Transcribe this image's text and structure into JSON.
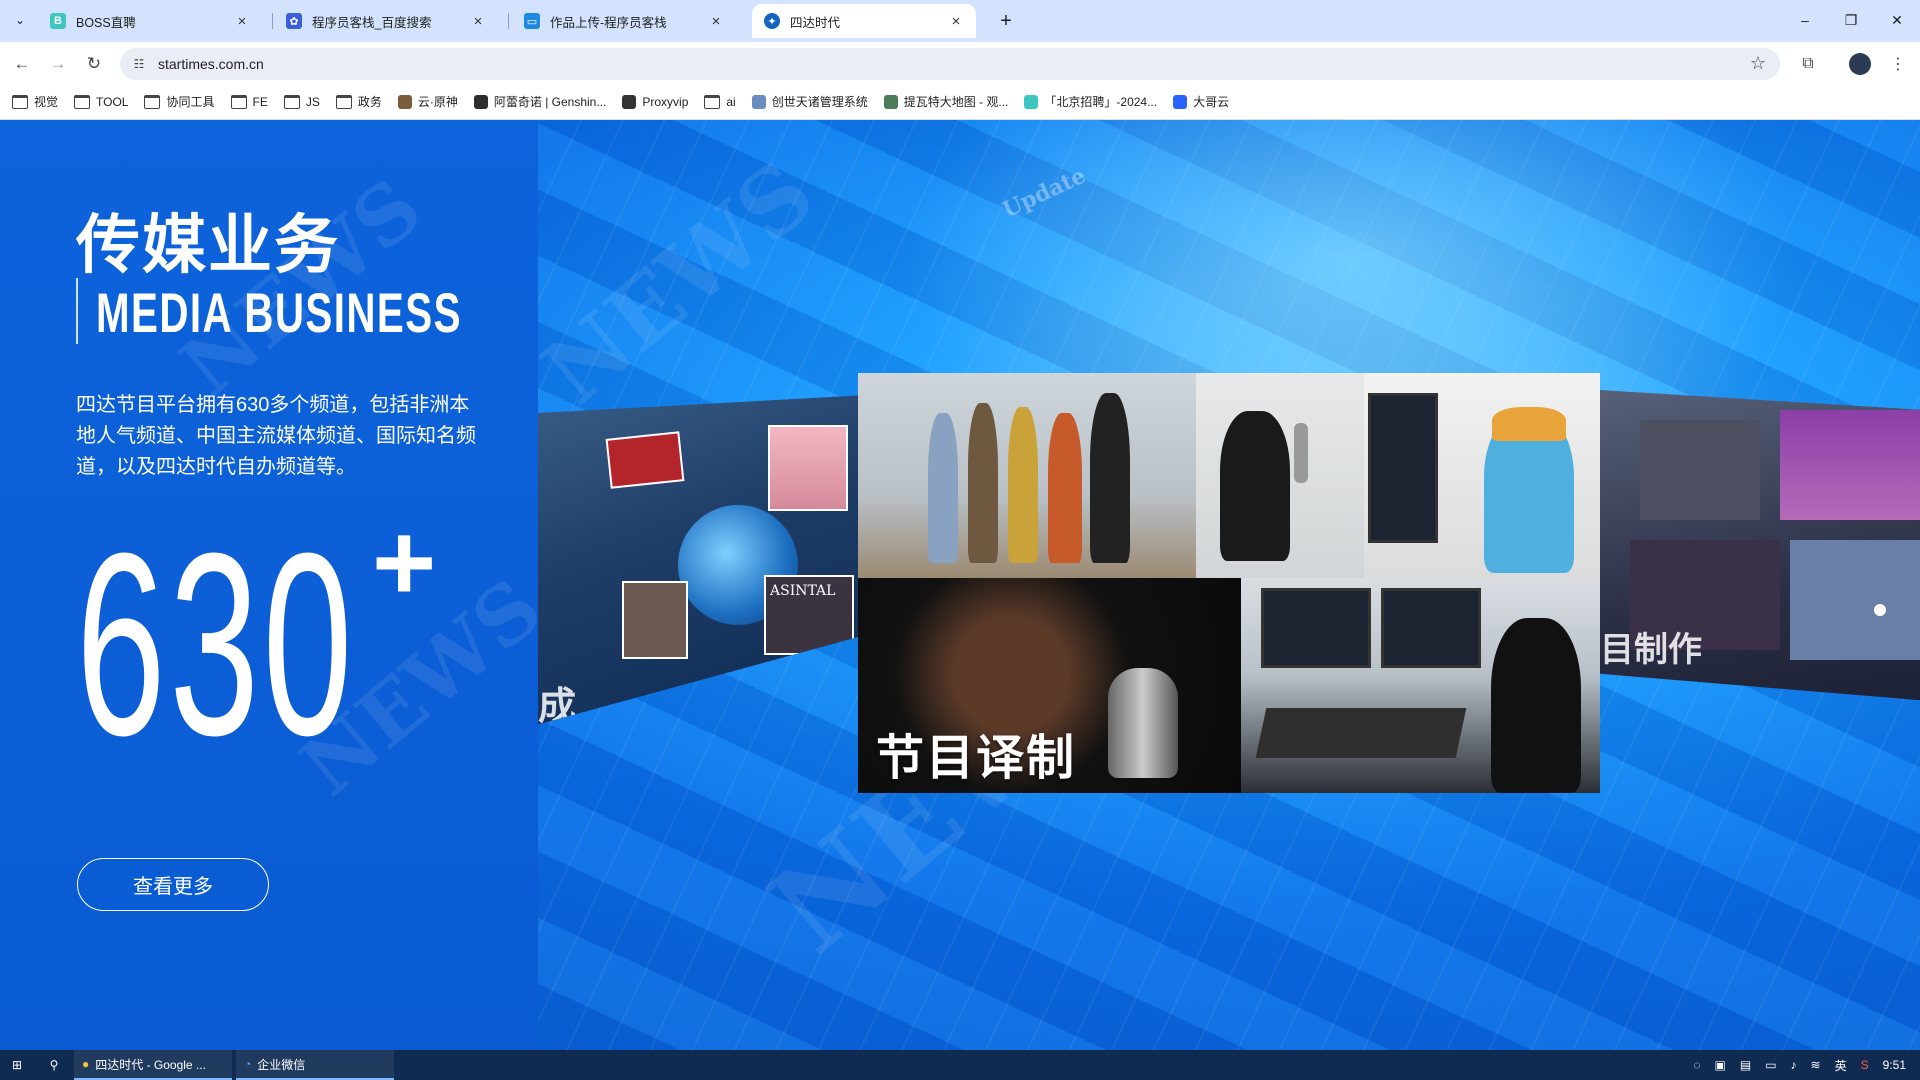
{
  "browser": {
    "tabs": [
      {
        "title": "BOSS直聘",
        "favicon": "B",
        "favicon_color": "#3fc6c0",
        "active": false
      },
      {
        "title": "程序员客栈_百度搜索",
        "favicon": "paw",
        "favicon_color": "#3a5fd9",
        "active": false
      },
      {
        "title": "作品上传-程序员客栈",
        "favicon": "box",
        "favicon_color": "#1e88e5",
        "active": false
      },
      {
        "title": "四达时代",
        "favicon": "globe",
        "favicon_color": "#1565c0",
        "active": true
      }
    ],
    "url": "startimes.com.cn",
    "bookmarks": [
      {
        "label": "视觉",
        "type": "folder"
      },
      {
        "label": "TOOL",
        "type": "folder"
      },
      {
        "label": "协同工具",
        "type": "folder"
      },
      {
        "label": "FE",
        "type": "folder"
      },
      {
        "label": "JS",
        "type": "folder"
      },
      {
        "label": "政务",
        "type": "folder"
      },
      {
        "label": "云·原神",
        "type": "site",
        "color": "#7a5c3a"
      },
      {
        "label": "阿蕾奇诺 | Genshin...",
        "type": "site",
        "color": "#2d2d2d"
      },
      {
        "label": "Proxyvip",
        "type": "site",
        "color": "#333333"
      },
      {
        "label": "ai",
        "type": "folder"
      },
      {
        "label": "创世天诸管理系统",
        "type": "site",
        "color": "#6c8ebf"
      },
      {
        "label": "提瓦特大地图 - 观...",
        "type": "site",
        "color": "#4a7c59"
      },
      {
        "label": "「北京招聘」-2024...",
        "type": "site",
        "color": "#3fc6c0"
      },
      {
        "label": "大哥云",
        "type": "site",
        "color": "#2962ff"
      }
    ]
  },
  "hero": {
    "title_cn": "传媒业务",
    "title_en": "MEDIA BUSINESS",
    "description": "四达节目平台拥有630多个频道，包括非洲本地人气频道、中国主流媒体频道、国际知名频道，以及四达时代自办频道等。",
    "stat_number": "630",
    "stat_suffix": "+",
    "more_button": "查看更多"
  },
  "carousel": {
    "main_label": "节目译制",
    "left_label": "成",
    "right_label": "目制作",
    "left_items": [
      "ASINTAL",
      "NEWS"
    ],
    "right_items": [
      "Update"
    ]
  },
  "taskbar": {
    "apps": [
      {
        "label": "四达时代 - Google ...",
        "icon": "chrome-icon"
      },
      {
        "label": "企业微信",
        "icon": "wecom-icon"
      }
    ],
    "ime": "英",
    "time": "9:51"
  }
}
